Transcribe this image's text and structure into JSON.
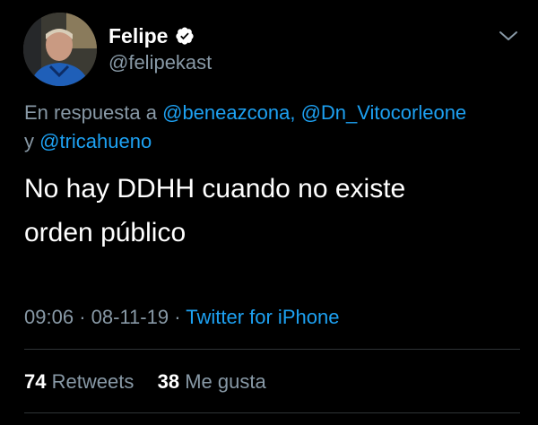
{
  "author": {
    "name": "Felipe",
    "handle": "@felipekast",
    "verified_icon": "verified-badge-icon",
    "avatar_icon": "profile-photo"
  },
  "reply": {
    "prefix": "En respuesta a",
    "mentions": [
      "@beneazcona",
      "@Dn_Vitocorleone",
      "@tricahueno"
    ],
    "separator_comma": ",",
    "separator_and": "y"
  },
  "tweet": {
    "line1": "No hay DDHH cuando no existe",
    "line2": "orden público"
  },
  "meta": {
    "time": "09:06",
    "date": "08-11-19",
    "dot": "·",
    "source": "Twitter for iPhone"
  },
  "stats": {
    "retweets_count": "74",
    "retweets_label": "Retweets",
    "likes_count": "38",
    "likes_label": "Me gusta"
  },
  "colors": {
    "background": "#000000",
    "secondary_text": "#8899a6",
    "link": "#1da1f2",
    "divider": "#2f3336"
  }
}
